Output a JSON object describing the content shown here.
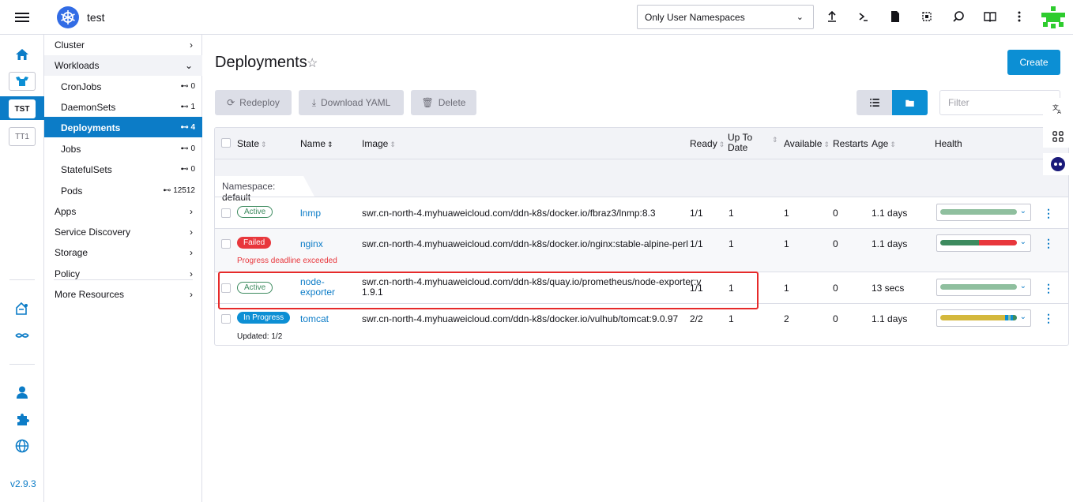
{
  "header": {
    "cluster_name": "test",
    "namespace_filter": "Only User Namespaces",
    "icons": [
      "upload-icon",
      "terminal-icon",
      "file-icon",
      "copy-kubeconfig-icon",
      "search-icon",
      "book-icon",
      "more-vertical-icon"
    ]
  },
  "rail": {
    "items": [
      {
        "name": "home-icon"
      },
      {
        "name": "local-cluster-icon"
      },
      {
        "label": "TST"
      },
      {
        "label": "TT1"
      }
    ],
    "version": "v2.9.3"
  },
  "nav": {
    "groups": [
      {
        "label": "Cluster"
      },
      {
        "label": "Workloads"
      },
      {
        "label": "Apps"
      },
      {
        "label": "Service Discovery"
      },
      {
        "label": "Storage"
      },
      {
        "label": "Policy"
      },
      {
        "label": "More Resources"
      }
    ],
    "items": [
      {
        "label": "CronJobs",
        "count": "0"
      },
      {
        "label": "DaemonSets",
        "count": "1"
      },
      {
        "label": "Deployments",
        "count": "4"
      },
      {
        "label": "Jobs",
        "count": "0"
      },
      {
        "label": "StatefulSets",
        "count": "0"
      },
      {
        "label": "Pods",
        "count": "12512"
      }
    ]
  },
  "main": {
    "title": "Deployments",
    "create_label": "Create",
    "redeploy_label": "Redeploy",
    "download_label": "Download YAML",
    "delete_label": "Delete",
    "filter_placeholder": "Filter"
  },
  "table": {
    "headers": {
      "state": "State",
      "name": "Name",
      "image": "Image",
      "ready": "Ready",
      "uptodate": "Up To Date",
      "available": "Available",
      "restarts": "Restarts",
      "age": "Age",
      "health": "Health"
    },
    "namespace_label": "Namespace:",
    "namespace_value": "default",
    "rows": [
      {
        "state": "Active",
        "name": "lnmp",
        "image": "swr.cn-north-4.myhuaweicloud.com/ddn-k8s/docker.io/fbraz3/lnmp:8.3",
        "ready": "1/1",
        "uptodate": "1",
        "available": "1",
        "restarts": "0",
        "age": "1.1 days"
      },
      {
        "state": "Failed",
        "name": "nginx",
        "image": "swr.cn-north-4.myhuaweicloud.com/ddn-k8s/docker.io/nginx:stable-alpine-perl",
        "ready": "1/1",
        "uptodate": "1",
        "available": "1",
        "restarts": "0",
        "age": "1.1 days",
        "message": "Progress deadline exceeded"
      },
      {
        "state": "Active",
        "name_line1": "node-",
        "name_line2": "exporter",
        "image_line1": "swr.cn-north-4.myhuaweicloud.com/ddn-k8s/quay.io/prometheus/node-exporter:v",
        "image_line2": "1.9.1",
        "ready": "1/1",
        "uptodate": "1",
        "available": "1",
        "restarts": "0",
        "age": "13 secs"
      },
      {
        "state": "In Progress",
        "name": "tomcat",
        "image": "swr.cn-north-4.myhuaweicloud.com/ddn-k8s/docker.io/vulhub/tomcat:9.0.97",
        "ready": "2/2",
        "uptodate": "1",
        "available": "2",
        "restarts": "0",
        "age": "1.1 days",
        "message": "Updated: 1/2"
      }
    ]
  },
  "colors": {
    "primary": "#0c8fd4",
    "active_green": "#3d8b5f",
    "failed_red": "#e8373c",
    "health_ok": "#8fbf9e",
    "health_warn": "#d4b83c",
    "highlight": "#e62a2a"
  }
}
